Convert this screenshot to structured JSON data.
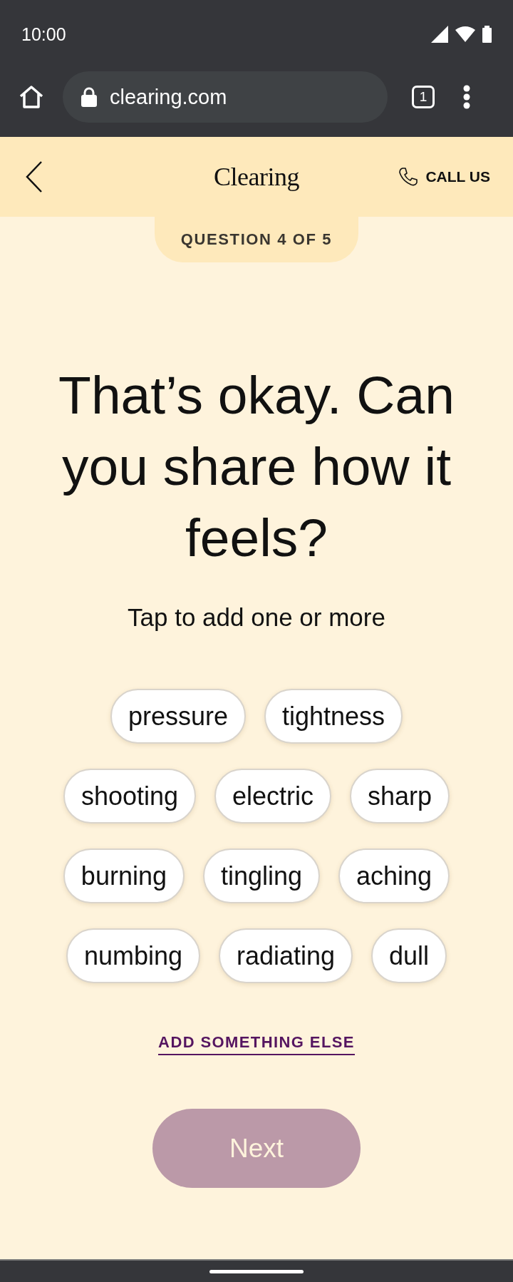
{
  "status_bar": {
    "time": "10:00"
  },
  "browser": {
    "url": "clearing.com",
    "tab_count": "1"
  },
  "header": {
    "logo": "Clearing",
    "call_label": "CALL US"
  },
  "progress": {
    "label": "QUESTION 4 OF 5"
  },
  "question": {
    "title": "That’s okay. Can you share how it feels?",
    "hint": "Tap to add one or more"
  },
  "options": [
    {
      "label": "pressure",
      "selected": false
    },
    {
      "label": "tightness",
      "selected": false
    },
    {
      "label": "shooting",
      "selected": false
    },
    {
      "label": "electric",
      "selected": false
    },
    {
      "label": "sharp",
      "selected": false
    },
    {
      "label": "burning",
      "selected": false
    },
    {
      "label": "tingling",
      "selected": false
    },
    {
      "label": "aching",
      "selected": false
    },
    {
      "label": "numbing",
      "selected": false
    },
    {
      "label": "radiating",
      "selected": false
    },
    {
      "label": "dull",
      "selected": false
    }
  ],
  "add_link": "ADD SOMETHING ELSE",
  "next_button": {
    "label": "Next",
    "disabled": true
  }
}
